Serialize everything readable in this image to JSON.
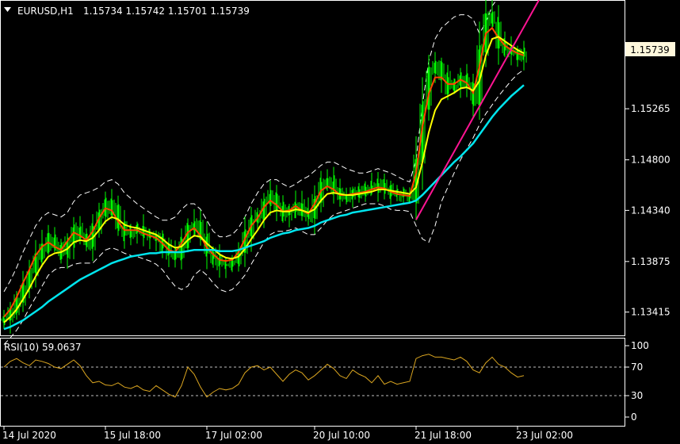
{
  "header": {
    "symbol": "EURUSD,H1",
    "ohlc": "1.15734 1.15742 1.15701 1.15739"
  },
  "price_tag": "1.15739",
  "rsi_label": "RSI(10) 59.0637",
  "colors": {
    "background": "#000000",
    "frame": "#ffffff",
    "candles": "#00ff00",
    "bollinger": "#ffffff",
    "ema_fast": "#ff4500",
    "ema_mid": "#ffff00",
    "ma_slow": "#00e5ee",
    "trendline": "#ff1493",
    "rsi": "#daa520",
    "rsi_levels": "#c0c0c0",
    "price_tag_bg": "#fff8dc"
  },
  "chart_data": [
    {
      "type": "line",
      "title": "EURUSD,H1",
      "x_tick_labels": [
        "14 Jul 2020",
        "15 Jul 18:00",
        "17 Jul 02:00",
        "20 Jul 10:00",
        "21 Jul 18:00",
        "23 Jul 02:00"
      ],
      "y_tick_labels": [
        "1.15265",
        "1.14800",
        "1.14340",
        "1.13875",
        "1.13415"
      ],
      "ylim": [
        1.1321,
        1.1624
      ],
      "last_price": 1.15739,
      "grid": false,
      "series": [
        {
          "style": "candles",
          "values": [
            1.1335,
            1.1342,
            1.1352,
            1.1365,
            1.1378,
            1.1392,
            1.1401,
            1.1408,
            1.1402,
            1.1395,
            1.1405,
            1.1418,
            1.141,
            1.1403,
            1.1418,
            1.1432,
            1.144,
            1.1435,
            1.142,
            1.1412,
            1.1415,
            1.1417,
            1.1412,
            1.141,
            1.1408,
            1.1402,
            1.1395,
            1.1393,
            1.1405,
            1.1418,
            1.1422,
            1.141,
            1.1395,
            1.139,
            1.1385,
            1.1385,
            1.1388,
            1.1397,
            1.1412,
            1.1425,
            1.143,
            1.1442,
            1.1447,
            1.1438,
            1.143,
            1.1433,
            1.144,
            1.1432,
            1.1428,
            1.1443,
            1.1458,
            1.146,
            1.1453,
            1.1445,
            1.1447,
            1.145,
            1.1452,
            1.1453,
            1.1455,
            1.1458,
            1.1454,
            1.145,
            1.1448,
            1.1447,
            1.1446,
            1.148,
            1.153,
            1.156,
            1.1565,
            1.1555,
            1.1545,
            1.1548,
            1.1555,
            1.1548,
            1.1535,
            1.158,
            1.1612,
            1.1605,
            1.1585,
            1.158,
            1.1578,
            1.1576,
            1.1574
          ]
        },
        {
          "name": "",
          "style": "ema",
          "values": [
            1.1337,
            1.1344,
            1.1355,
            1.1368,
            1.138,
            1.1393,
            1.1401,
            1.1405,
            1.1401,
            1.1398,
            1.1406,
            1.1414,
            1.1411,
            1.1407,
            1.1415,
            1.1427,
            1.1436,
            1.1434,
            1.1424,
            1.1416,
            1.1416,
            1.1416,
            1.1413,
            1.1411,
            1.1409,
            1.1404,
            1.1398,
            1.1396,
            1.1404,
            1.1414,
            1.1418,
            1.1411,
            1.14,
            1.1394,
            1.1389,
            1.1388,
            1.1389,
            1.1396,
            1.1408,
            1.142,
            1.1427,
            1.1437,
            1.1443,
            1.1439,
            1.1433,
            1.1434,
            1.1438,
            1.1434,
            1.1431,
            1.144,
            1.1452,
            1.1456,
            1.1453,
            1.1448,
            1.1448,
            1.1449,
            1.145,
            1.1451,
            1.1453,
            1.1455,
            1.1454,
            1.1451,
            1.1449,
            1.1448,
            1.1447,
            1.1468,
            1.151,
            1.154,
            1.1555,
            1.1555,
            1.1549,
            1.1549,
            1.1553,
            1.155,
            1.1541,
            1.1565,
            1.1595,
            1.16,
            1.1591,
            1.1584,
            1.158,
            1.1577,
            1.1575
          ]
        },
        {
          "name": "",
          "style": "ema",
          "values": [
            1.1332,
            1.1337,
            1.1344,
            1.1353,
            1.1363,
            1.1374,
            1.1384,
            1.1392,
            1.1395,
            1.1396,
            1.1399,
            1.1405,
            1.1407,
            1.1406,
            1.1409,
            1.1416,
            1.1424,
            1.1428,
            1.1426,
            1.1421,
            1.1419,
            1.1418,
            1.1416,
            1.1414,
            1.1412,
            1.1408,
            1.1403,
            1.14,
            1.1401,
            1.1407,
            1.1411,
            1.141,
            1.1404,
            1.1399,
            1.1394,
            1.1391,
            1.139,
            1.1392,
            1.1399,
            1.1408,
            1.1416,
            1.1425,
            1.1432,
            1.1434,
            1.1433,
            1.1433,
            1.1435,
            1.1434,
            1.1432,
            1.1435,
            1.1443,
            1.1449,
            1.145,
            1.1449,
            1.1448,
            1.1448,
            1.1449,
            1.145,
            1.1451,
            1.1453,
            1.1453,
            1.1452,
            1.1451,
            1.145,
            1.1449,
            1.1455,
            1.1478,
            1.1505,
            1.1525,
            1.1535,
            1.1538,
            1.1541,
            1.1545,
            1.1546,
            1.1543,
            1.1552,
            1.1575,
            1.159,
            1.1592,
            1.1588,
            1.1584,
            1.158,
            1.1577
          ]
        },
        {
          "name": "",
          "style": "ma",
          "values": [
            1.1326,
            1.1328,
            1.1331,
            1.1334,
            1.1338,
            1.1342,
            1.1346,
            1.1351,
            1.1355,
            1.1359,
            1.1363,
            1.1367,
            1.1371,
            1.1374,
            1.1377,
            1.138,
            1.1383,
            1.1386,
            1.1388,
            1.139,
            1.1392,
            1.1393,
            1.1394,
            1.1395,
            1.1395,
            1.1396,
            1.1396,
            1.1396,
            1.1396,
            1.1397,
            1.1398,
            1.1398,
            1.1398,
            1.1398,
            1.1397,
            1.1397,
            1.1397,
            1.1398,
            1.14,
            1.1402,
            1.1404,
            1.1406,
            1.1409,
            1.1411,
            1.1413,
            1.1414,
            1.1416,
            1.1417,
            1.1418,
            1.142,
            1.1423,
            1.1425,
            1.1427,
            1.1429,
            1.143,
            1.1432,
            1.1433,
            1.1434,
            1.1435,
            1.1436,
            1.1437,
            1.1438,
            1.1439,
            1.144,
            1.1441,
            1.1443,
            1.1448,
            1.1454,
            1.146,
            1.1466,
            1.1472,
            1.1478,
            1.1483,
            1.1489,
            1.1495,
            1.1503,
            1.1511,
            1.1519,
            1.1526,
            1.1532,
            1.1538,
            1.1543,
            1.1548
          ]
        },
        {
          "name": "",
          "style": "band-upper",
          "values": [
            1.136,
            1.137,
            1.1382,
            1.1396,
            1.1408,
            1.142,
            1.1428,
            1.1432,
            1.143,
            1.1428,
            1.1432,
            1.1442,
            1.1448,
            1.145,
            1.1452,
            1.1455,
            1.146,
            1.1462,
            1.1458,
            1.145,
            1.1445,
            1.144,
            1.1436,
            1.1432,
            1.1428,
            1.1425,
            1.1425,
            1.1428,
            1.1435,
            1.144,
            1.144,
            1.1435,
            1.1425,
            1.1415,
            1.141,
            1.141,
            1.1412,
            1.1418,
            1.1428,
            1.144,
            1.145,
            1.1458,
            1.1462,
            1.1462,
            1.1458,
            1.1455,
            1.1458,
            1.1462,
            1.1465,
            1.147,
            1.1475,
            1.1478,
            1.1478,
            1.1475,
            1.1472,
            1.147,
            1.1468,
            1.1468,
            1.147,
            1.1472,
            1.147,
            1.1468,
            1.1465,
            1.1462,
            1.146,
            1.148,
            1.153,
            1.157,
            1.159,
            1.16,
            1.1605,
            1.161,
            1.1612,
            1.1612,
            1.1608,
            1.1595,
            1.1605,
            1.162,
            1.1628,
            1.1632,
            1.1634,
            1.1635,
            1.1635
          ]
        },
        {
          "name": "",
          "style": "band-lower",
          "values": [
            1.1312,
            1.1318,
            1.1325,
            1.1334,
            1.1345,
            1.1355,
            1.1365,
            1.1375,
            1.138,
            1.1382,
            1.1382,
            1.1385,
            1.1386,
            1.1386,
            1.1386,
            1.1392,
            1.1398,
            1.14,
            1.1398,
            1.1395,
            1.1393,
            1.1392,
            1.139,
            1.1388,
            1.1385,
            1.138,
            1.1372,
            1.1365,
            1.1362,
            1.1365,
            1.1375,
            1.138,
            1.1375,
            1.1368,
            1.1362,
            1.136,
            1.1362,
            1.1368,
            1.1375,
            1.1385,
            1.1395,
            1.1405,
            1.1412,
            1.1415,
            1.1415,
            1.1416,
            1.1418,
            1.1415,
            1.1412,
            1.1412,
            1.1418,
            1.1425,
            1.143,
            1.1432,
            1.1434,
            1.1436,
            1.1438,
            1.144,
            1.144,
            1.144,
            1.1438,
            1.1435,
            1.1434,
            1.1434,
            1.1433,
            1.142,
            1.1408,
            1.1405,
            1.142,
            1.1442,
            1.1455,
            1.1468,
            1.148,
            1.149,
            1.15,
            1.1512,
            1.1522,
            1.153,
            1.1538,
            1.1545,
            1.1552,
            1.1558,
            1.1562
          ]
        },
        {
          "name": "",
          "style": "trendline",
          "points": [
            [
              65,
              1.14255
            ],
            [
              84,
              1.1628
            ]
          ]
        }
      ]
    },
    {
      "type": "line",
      "title": "RSI(10) 59.0637",
      "ylim": [
        0,
        100
      ],
      "y_tick_labels": [
        "100",
        "70",
        "30",
        "0"
      ],
      "levels": [
        70,
        30
      ],
      "series": [
        {
          "name": "RSI(10)",
          "values": [
            70,
            78,
            82,
            76,
            72,
            80,
            78,
            75,
            70,
            68,
            74,
            80,
            72,
            58,
            48,
            50,
            45,
            44,
            48,
            42,
            40,
            44,
            38,
            36,
            44,
            38,
            32,
            28,
            44,
            70,
            60,
            42,
            28,
            35,
            40,
            38,
            40,
            46,
            62,
            70,
            72,
            66,
            70,
            60,
            50,
            60,
            66,
            62,
            52,
            58,
            66,
            74,
            68,
            58,
            54,
            66,
            60,
            56,
            48,
            58,
            46,
            50,
            46,
            48,
            50,
            82,
            86,
            88,
            84,
            84,
            82,
            80,
            84,
            78,
            66,
            62,
            76,
            84,
            74,
            70,
            62,
            56,
            58
          ]
        }
      ]
    }
  ]
}
